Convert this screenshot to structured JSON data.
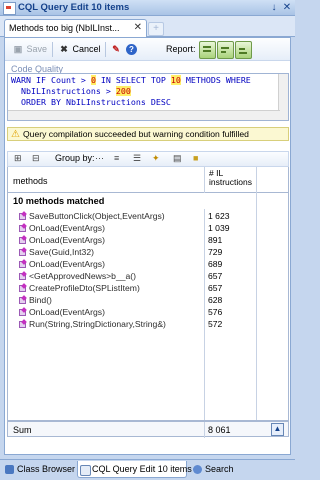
{
  "window": {
    "title": "CQL Query Edit  10 items",
    "pin_icon": "pin-icon",
    "close_icon": "close-icon"
  },
  "doc_tab": {
    "label": "Methods too big (NbILInst...",
    "close": "✕",
    "new_tab": "+"
  },
  "toolbar": {
    "save_label": "Save",
    "cancel_label": "Cancel",
    "report_label": "Report:"
  },
  "code_quality_link": "Code Quality",
  "editor": {
    "line1_a": "WARN IF Count > ",
    "line1_zero": "0",
    "line1_b": " IN SELECT TOP ",
    "line1_ten": "10",
    "line1_c": " METHODS WHERE",
    "line2_a": "  NbILInstructions > ",
    "line2_num": "200",
    "line3": "  ORDER BY NbILInstructions DESC"
  },
  "warning": {
    "icon": "warning-icon",
    "text": "Query compilation succeeded but warning condition fulfilled"
  },
  "grid_toolbar": {
    "group_by_label": "Group by:"
  },
  "grid": {
    "col_methods": "methods",
    "col_il_line1": "# IL",
    "col_il_line2": "instructions",
    "group_title": "10 methods matched",
    "rows": [
      {
        "name": "SaveButtonClick(Object,EventArgs)",
        "value": "1 623"
      },
      {
        "name": "OnLoad(EventArgs)",
        "value": "1 039"
      },
      {
        "name": "OnLoad(EventArgs)",
        "value": "891"
      },
      {
        "name": "Save(Guid,Int32)",
        "value": "729"
      },
      {
        "name": "OnLoad(EventArgs)",
        "value": "689"
      },
      {
        "name": "<GetApprovedNews>b__a()",
        "value": "657"
      },
      {
        "name": "CreateProfileDto(SPListItem)",
        "value": "657"
      },
      {
        "name": "Bind()",
        "value": "628"
      },
      {
        "name": "OnLoad(EventArgs)",
        "value": "576"
      },
      {
        "name": "Run(String,StringDictionary,String&)",
        "value": "572"
      }
    ],
    "sum_label": "Sum",
    "sum_value": "8 061"
  },
  "bottom_tabs": [
    {
      "label": "Class Browser"
    },
    {
      "label": "CQL Query Edit  10 items"
    },
    {
      "label": "Search"
    }
  ]
}
